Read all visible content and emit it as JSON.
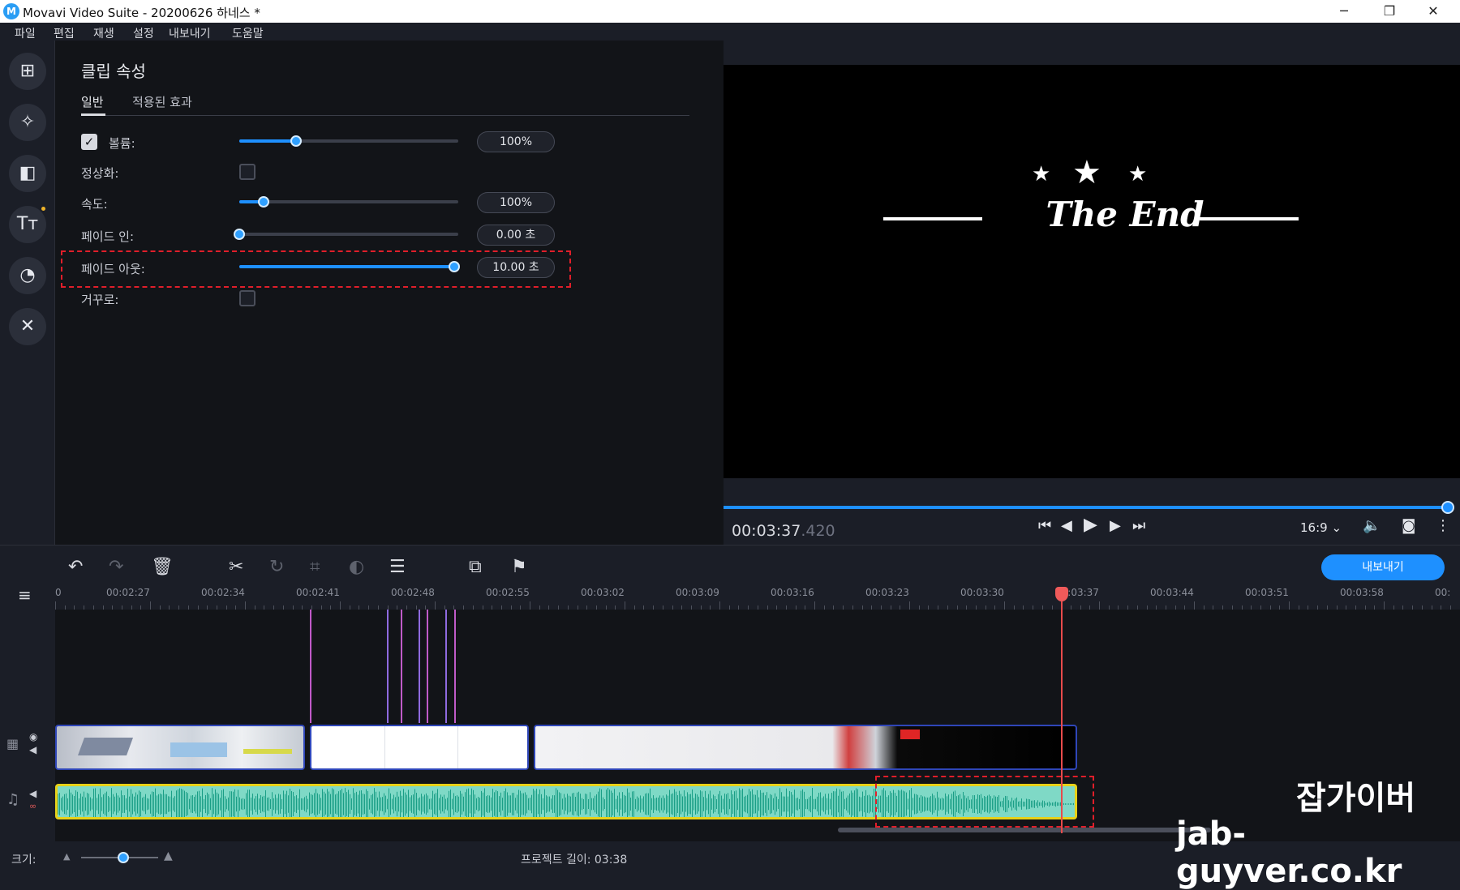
{
  "window": {
    "title": "Movavi Video Suite - 20200626 하네스 *",
    "minimize": "─",
    "maximize": "❐",
    "close": "✕"
  },
  "menu": [
    "파일",
    "편집",
    "재생",
    "설정",
    "내보내기",
    "도움말"
  ],
  "props": {
    "heading": "클립 속성",
    "tabs": [
      "일반",
      "적용된 효과"
    ],
    "rows": {
      "volume": {
        "label": "볼륨:",
        "value": "100%",
        "level": 0.26
      },
      "normalize": {
        "label": "정상화:"
      },
      "speed": {
        "label": "속도:",
        "value": "100%",
        "level": 0.11
      },
      "fade_in": {
        "label": "페이드 인:",
        "value": "0.00 초",
        "level": 0.0
      },
      "fade_out": {
        "label": "페이드 아웃:",
        "value": "10.00 초",
        "level": 0.98
      },
      "reverse": {
        "label": "거꾸로:"
      }
    }
  },
  "preview": {
    "title_text": "The End",
    "timecode": "00:03:37",
    "timecode_ms": ".420",
    "aspect": "16:9",
    "progress": 0.99
  },
  "timeline": {
    "export_label": "내보내기",
    "ruler": [
      "0",
      "00:02:27",
      "00:02:34",
      "00:02:41",
      "00:02:48",
      "00:02:55",
      "00:03:02",
      "00:03:09",
      "00:03:16",
      "00:03:23",
      "00:03:30",
      "00:03:37",
      "00:03:44",
      "00:03:51",
      "00:03:58",
      "00:"
    ]
  },
  "bottom": {
    "size_label": "크기:",
    "project_length": "프로젝트 길이: 03:38"
  },
  "watermark": {
    "line1": "잡가이버",
    "line2": "jab-guyver.co.kr"
  }
}
